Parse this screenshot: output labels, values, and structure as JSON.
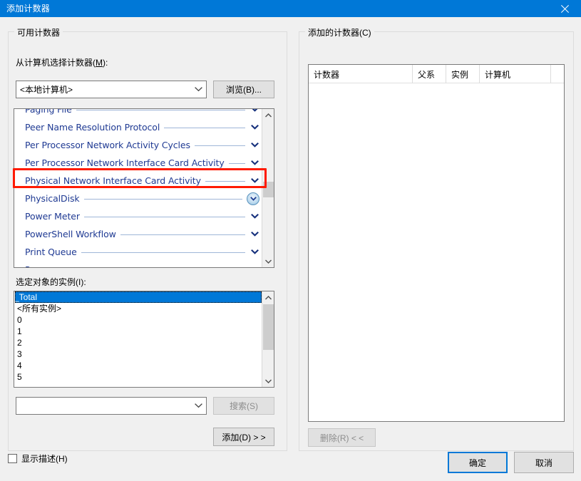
{
  "window": {
    "title": "添加计数器",
    "close_icon": "close-icon",
    "titlebar_color": "#0078d7"
  },
  "available_counters": {
    "group_label": "可用计数器",
    "machine_label": "从计算机选择计数器(M):",
    "machine_label_plain": "从计算机选择计数器",
    "machine_accel": "M",
    "machine_value": "<本地计算机>",
    "browse_button": "浏览(B)...",
    "counter_objects": [
      {
        "name": "Paging File",
        "expand_highlighted": false,
        "clipped": "top"
      },
      {
        "name": "Peer Name Resolution Protocol",
        "expand_highlighted": false
      },
      {
        "name": "Per Processor Network Activity Cycles",
        "expand_highlighted": false
      },
      {
        "name": "Per Processor Network Interface Card Activity",
        "expand_highlighted": false
      },
      {
        "name": "Physical Network Interface Card Activity",
        "expand_highlighted": false
      },
      {
        "name": "PhysicalDisk",
        "expand_highlighted": true,
        "annotated": true
      },
      {
        "name": "Power Meter",
        "expand_highlighted": false
      },
      {
        "name": "PowerShell Workflow",
        "expand_highlighted": false
      },
      {
        "name": "Print Queue",
        "expand_highlighted": false
      },
      {
        "name": "Process",
        "expand_highlighted": false,
        "clipped": "bottom"
      }
    ],
    "instances_label": "选定对象的实例(I):",
    "instances": [
      {
        "value": "_Total",
        "selected": true
      },
      {
        "value": "<所有实例>",
        "selected": false
      },
      {
        "value": "0",
        "selected": false
      },
      {
        "value": "1",
        "selected": false
      },
      {
        "value": "2",
        "selected": false
      },
      {
        "value": "3",
        "selected": false
      },
      {
        "value": "4",
        "selected": false
      },
      {
        "value": "5",
        "selected": false
      }
    ],
    "search_value": "",
    "search_placeholder": "",
    "search_button": "搜索(S)",
    "search_button_enabled": false,
    "add_button": "添加(D)  > >",
    "add_button_enabled": true
  },
  "added_counters": {
    "group_label": "添加的计数器(C)",
    "columns": [
      "计数器",
      "父系",
      "实例",
      "计算机"
    ],
    "rows": [],
    "remove_button": "删除(R)  < <",
    "remove_button_enabled": false
  },
  "footer": {
    "show_description_label": "显示描述(H)",
    "show_description_checked": false,
    "ok_button": "确定",
    "cancel_button": "取消"
  },
  "annotation": {
    "color": "#ff1a00",
    "target": "PhysicalDisk"
  }
}
